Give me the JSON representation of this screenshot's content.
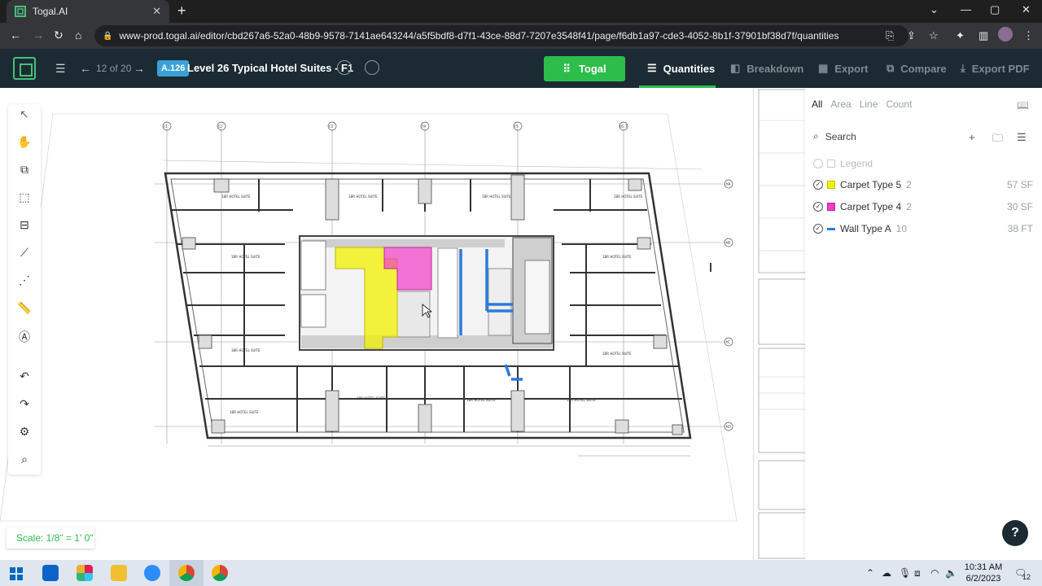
{
  "browser": {
    "tab_title": "Togal.AI",
    "tab_close": "✕",
    "new_tab": "+",
    "url": "www-prod.togal.ai/editor/cbd267a6-52a0-48b9-9578-7141ae643244/a5f5bdf8-d7f1-43ce-88d7-7207e3548f41/page/f6db1a97-cde3-4052-8b1f-37901bf38d7f/quantities"
  },
  "app_toolbar": {
    "pager": "12 of 20",
    "sheet_badge": "A.126",
    "sheet_name": "Level 26 Typical Hotel Suites - F1",
    "togal_button": "Togal",
    "menu": [
      {
        "label": "Quantities",
        "active": true
      },
      {
        "label": "Breakdown",
        "active": false
      },
      {
        "label": "Export",
        "active": false
      },
      {
        "label": "Compare",
        "active": false
      },
      {
        "label": "Export PDF",
        "active": false
      }
    ]
  },
  "panel": {
    "tabs": [
      "All",
      "Area",
      "Line",
      "Count"
    ],
    "active_tab": "All",
    "search_placeholder": "Search",
    "legend_label": "Legend",
    "items": [
      {
        "name": "Carpet Type 5",
        "count": "2",
        "value": "57 SF",
        "color": "#f2f200"
      },
      {
        "name": "Carpet Type 4",
        "count": "2",
        "value": "30 SF",
        "color": "#f03cc8"
      },
      {
        "name": "Wall Type A",
        "count": "10",
        "value": "38 FT",
        "color": "#2d7bd8"
      }
    ]
  },
  "scale_label": "Scale: 1/8\" = 1' 0\"",
  "help_label": "?",
  "taskbar": {
    "time": "10:31 AM",
    "date": "6/2/2023",
    "notif_count": "12"
  },
  "colors": {
    "toolbar_bg": "#1c2b33",
    "accent_green": "#2dbd4b",
    "sheet_badge_blue": "#3aa0d8"
  }
}
